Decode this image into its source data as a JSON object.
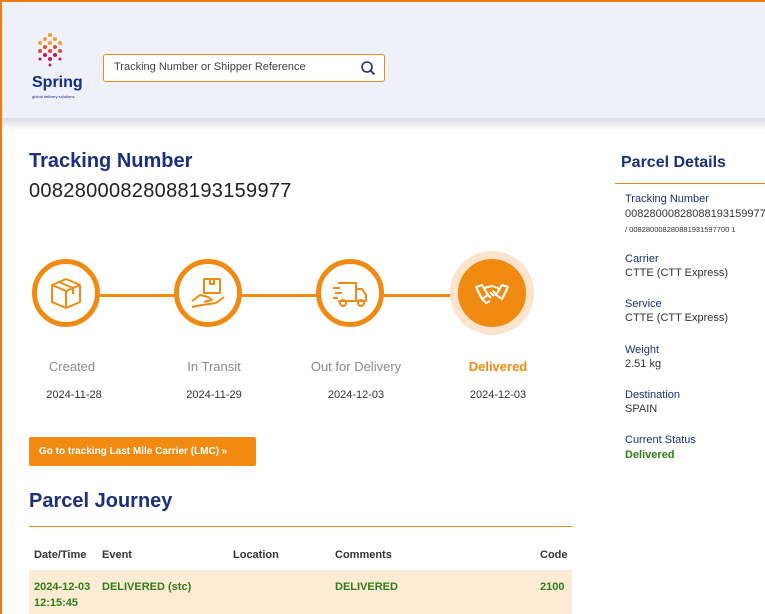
{
  "brand": {
    "name": "Spring",
    "tagline": "global delivery solutions",
    "color": "#142a8c"
  },
  "search": {
    "placeholder": "Tracking Number or Shipper Reference",
    "value": ""
  },
  "tracking": {
    "label": "Tracking Number",
    "number": "00828000828088193159977"
  },
  "steps": [
    {
      "label": "Created",
      "date": "2024-11-28",
      "icon": "box-icon",
      "active": false
    },
    {
      "label": "In Transit",
      "date": "2024-11-29",
      "icon": "hand-box-icon",
      "active": false
    },
    {
      "label": "Out for Delivery",
      "date": "2024-12-03",
      "icon": "truck-icon",
      "active": false
    },
    {
      "label": "Delivered",
      "date": "2024-12-03",
      "icon": "handshake-icon",
      "active": true
    }
  ],
  "lmc_button": "Go to tracking Last Mile Carrier (LMC) »",
  "journey": {
    "title": "Parcel Journey",
    "columns": [
      "Date/Time",
      "Event",
      "Location",
      "Comments",
      "Code"
    ],
    "rows": [
      {
        "date": "2024-12-03",
        "time": "12:15:45",
        "event": "DELIVERED (stc)",
        "location": "",
        "comments": "DELIVERED",
        "code": "2100"
      }
    ]
  },
  "details": {
    "title": "Parcel Details",
    "tracking_label": "Tracking Number",
    "tracking_value": "00828000828088193159977",
    "tracking_sub": "/ 008280008280881931597700 1",
    "carrier_label": "Carrier",
    "carrier_value": "CTTE  (CTT Express)",
    "service_label": "Service",
    "service_value": "CTTE  (CTT Express)",
    "weight_label": "Weight",
    "weight_value": "2.51 kg",
    "destination_label": "Destination",
    "destination_value": "SPAIN",
    "status_label": "Current Status",
    "status_value": "Delivered"
  },
  "colors": {
    "accent": "#f08a10",
    "navy": "#1c2f7d",
    "status_green": "#2e7d16",
    "row_highlight": "#fdebd6"
  }
}
